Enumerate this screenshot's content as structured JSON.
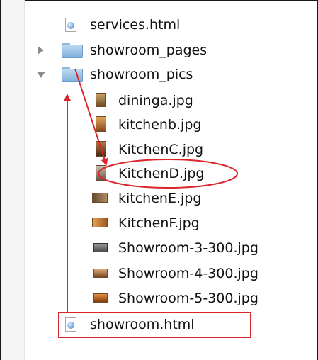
{
  "files": [
    {
      "name": "services.html",
      "kind": "html"
    },
    {
      "name": "showroom_pages",
      "kind": "folder",
      "state": "collapsed"
    },
    {
      "name": "showroom_pics",
      "kind": "folder",
      "state": "expanded"
    },
    {
      "name": "dininga.jpg",
      "kind": "image",
      "thumb": "portrait-brown"
    },
    {
      "name": "kitchenb.jpg",
      "kind": "image",
      "thumb": "portrait-orange"
    },
    {
      "name": "KitchenC.jpg",
      "kind": "image",
      "thumb": "portrait-dark"
    },
    {
      "name": "KitchenD.jpg",
      "kind": "image",
      "thumb": "portrait-grey"
    },
    {
      "name": "kitchenE.jpg",
      "kind": "image",
      "thumb": "landscape-dark"
    },
    {
      "name": "KitchenF.jpg",
      "kind": "image",
      "thumb": "landscape-orange"
    },
    {
      "name": "Showroom-3-300.jpg",
      "kind": "image",
      "thumb": "landscape-grey"
    },
    {
      "name": "Showroom-4-300.jpg",
      "kind": "image",
      "thumb": "landscape-brown"
    },
    {
      "name": "Showroom-5-300.jpg",
      "kind": "image",
      "thumb": "landscape-orange"
    },
    {
      "name": "showroom.html",
      "kind": "html"
    }
  ],
  "annotation_color": "#d9262c",
  "folder_color": "#7fb0dc"
}
